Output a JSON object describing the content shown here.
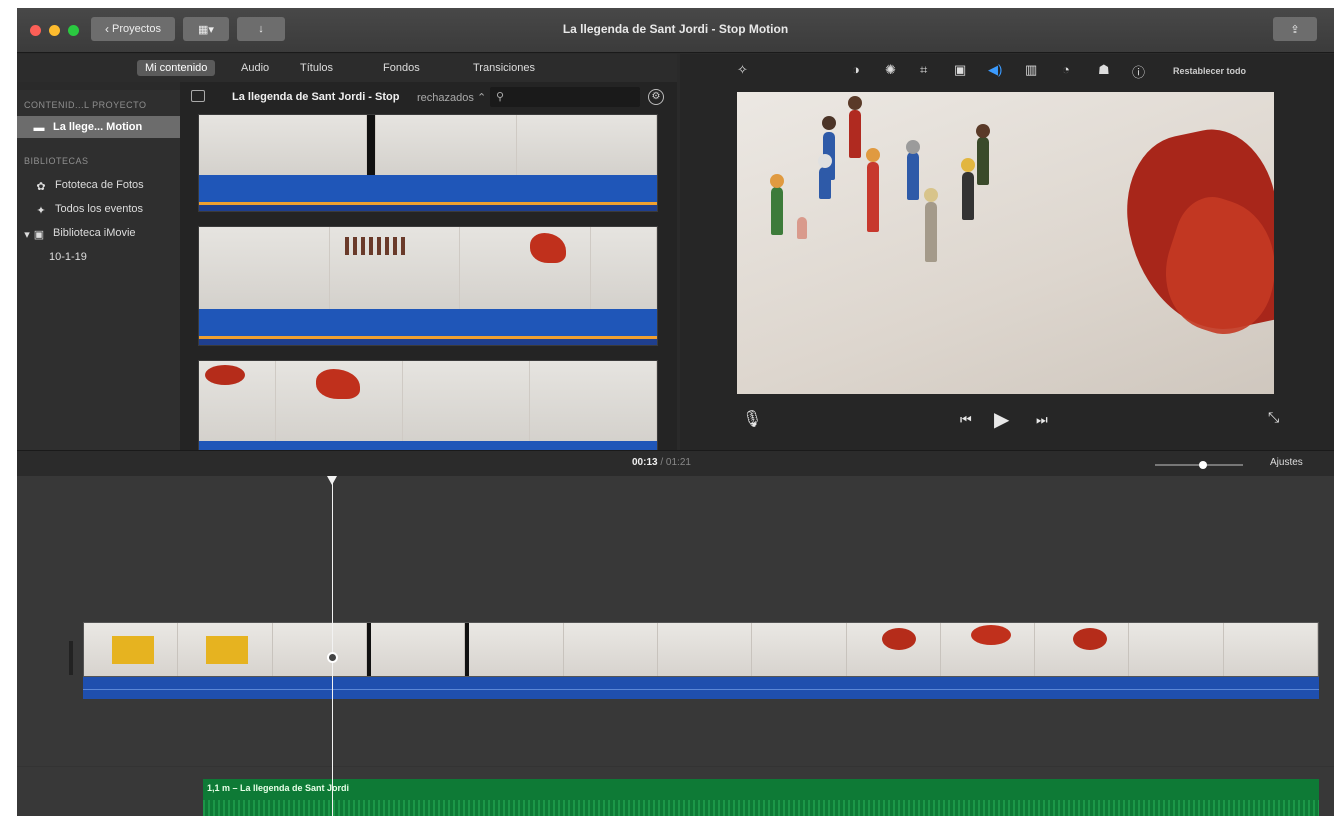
{
  "window": {
    "title": "La llegenda de Sant Jordi - Stop Motion"
  },
  "toolbar": {
    "projects_label": "Proyectos"
  },
  "browser_tabs": [
    "Mi contenido",
    "Audio",
    "Títulos",
    "Fondos",
    "Transiciones"
  ],
  "sidebar": {
    "project_header": "CONTENID...L PROYECTO",
    "project_item": "La llege... Motion",
    "libraries_header": "BIBLIOTECAS",
    "items": [
      {
        "label": "Fototeca de Fotos",
        "icon": "photos-icon"
      },
      {
        "label": "Todos los eventos",
        "icon": "star-icon"
      },
      {
        "label": "Biblioteca iMovie",
        "icon": "library-icon"
      }
    ],
    "event": "10-1-19"
  },
  "browser": {
    "event_title": "La llegenda de Sant Jordi - Stop",
    "filter": "rechazados",
    "search_placeholder": ""
  },
  "viewer": {
    "reset_label": "Restablecer todo"
  },
  "timeline": {
    "current_time": "00:13",
    "total_time": "01:21",
    "settings_label": "Ajustes",
    "zoom_level": 0.55,
    "music_label": "1,1 m – La llegenda de Sant Jordi"
  }
}
